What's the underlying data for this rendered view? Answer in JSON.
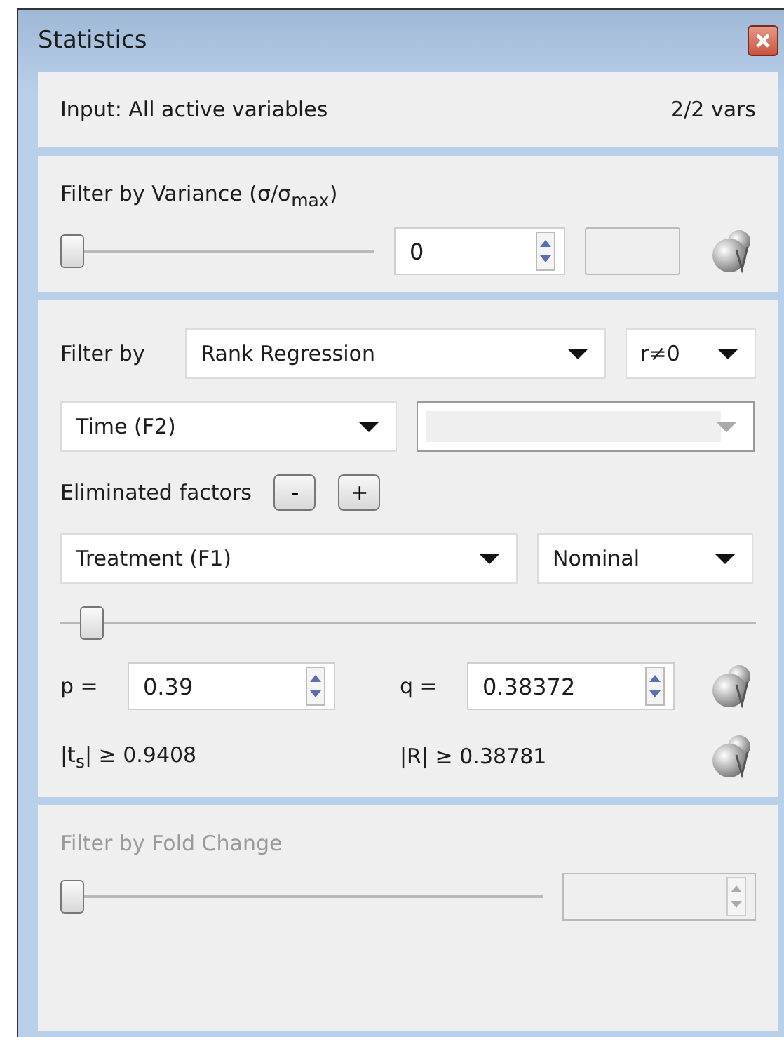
{
  "window": {
    "title": "Statistics"
  },
  "input": {
    "label": "Input: All active variables",
    "count": "2/2 vars"
  },
  "variance_filter": {
    "title": "Filter by Variance (σ/σ$_{max}$)",
    "level": 0,
    "value": "0"
  },
  "regression_filter": {
    "label": "Filter by",
    "method": "Rank Regression",
    "test": "r≠0",
    "factor": "Time (F2)",
    "factor_2": {
      "disabled": true
    },
    "eliminated_label": "Eliminated factors",
    "remove_button": "-",
    "add_button": "+",
    "eliminated_factor": "Treatment (F1)",
    "scale": "Nominal",
    "level": 0.03,
    "p_label": "p =",
    "p": "0.39",
    "q_label": "q =",
    "q": "0.38372",
    "t_threshold": "|t$_{s}$| ≥ 0.9408",
    "r_threshold": "|R| ≥ 0.38781"
  },
  "fold_change_filter": {
    "title": "Filter by Fold Change",
    "disabled": true,
    "level": 0
  }
}
